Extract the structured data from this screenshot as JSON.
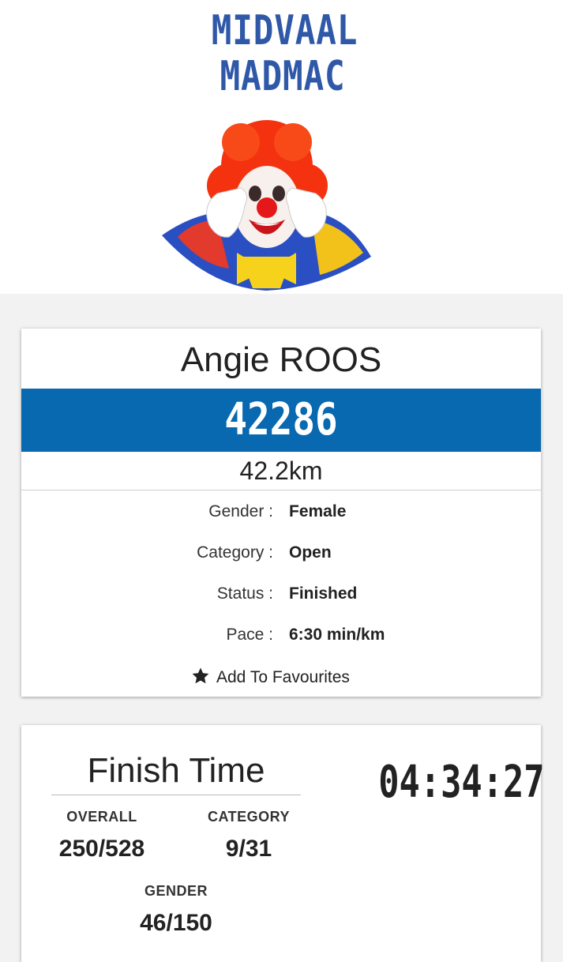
{
  "event": {
    "logo_line1": "MIDVAAL",
    "logo_line2": "MADMAC"
  },
  "runner": {
    "name": "Angie ROOS",
    "bib": "42286",
    "distance": "42.2km",
    "details": [
      {
        "label": "Gender :",
        "value": "Female"
      },
      {
        "label": "Category :",
        "value": "Open"
      },
      {
        "label": "Status :",
        "value": "Finished"
      },
      {
        "label": "Pace :",
        "value": "6:30 min/km"
      }
    ],
    "favourite_label": "Add To Favourites"
  },
  "result": {
    "title": "Finish Time",
    "time": "04:34:27",
    "overall_label": "OVERALL",
    "overall_value": "250/528",
    "category_label": "CATEGORY",
    "category_value": "9/31",
    "gender_label": "GENDER",
    "gender_value": "46/150"
  },
  "colors": {
    "bib_bar": "#0869b0",
    "logo_text": "#2f58a8"
  },
  "icons": {
    "favourite": "star-icon",
    "event_mascot": "clown-image"
  }
}
